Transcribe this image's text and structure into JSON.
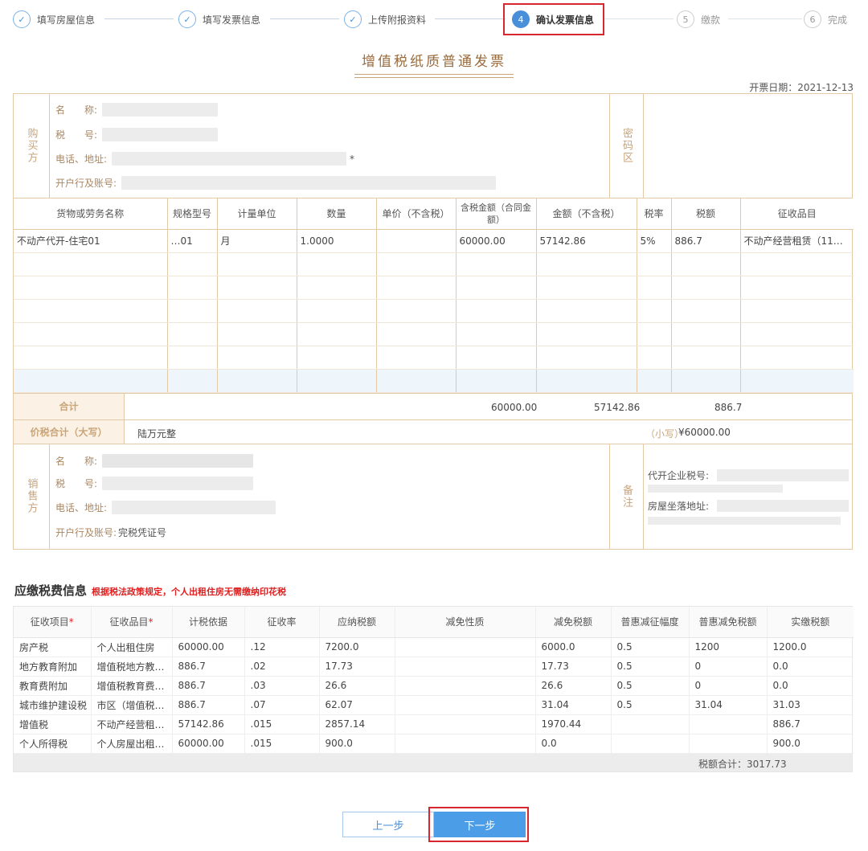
{
  "steps": [
    {
      "num": "✓",
      "label": "填写房屋信息",
      "state": "done"
    },
    {
      "num": "✓",
      "label": "填写发票信息",
      "state": "done"
    },
    {
      "num": "✓",
      "label": "上传附报资料",
      "state": "done"
    },
    {
      "num": "4",
      "label": "确认发票信息",
      "state": "active"
    },
    {
      "num": "5",
      "label": "缴款",
      "state": "todo"
    },
    {
      "num": "6",
      "label": "完成",
      "state": "todo"
    }
  ],
  "invoice": {
    "title": "增值税纸质普通发票",
    "date": "开票日期：2021-12-13",
    "buyer": {
      "side_label": "购买方",
      "name_label": "名　　称:",
      "tax_label": "税　　号:",
      "phone_label": "电话、地址:",
      "phone_mark": "*",
      "bank_label": "开户行及账号:"
    },
    "password_label": "密码区",
    "columns": [
      "货物或劳务名称",
      "规格型号",
      "计量单位",
      "数量",
      "单价（不含税）",
      "含税金额（合同金额）",
      "金额（不含税）",
      "税率",
      "税额",
      "征收品目"
    ],
    "item": {
      "name": "不动产代开-住宅01",
      "spec": "…01",
      "unit": "月",
      "qty": "1.0000",
      "price": "",
      "amount_incl": "60000.00",
      "amount_excl": "57142.86",
      "rate": "5%",
      "tax": "886.7",
      "category": "不动产经营租赁（11…"
    },
    "sum_label": "合计",
    "sum_amount_incl": "60000.00",
    "sum_amount_excl": "57142.86",
    "sum_tax": "886.7",
    "total_label": "价税合计（大写）",
    "total_words": "陆万元整",
    "total_small_label": "（小写）",
    "total_small": "¥60000.00",
    "seller": {
      "side_label": "销售方",
      "name_label": "名　　称:",
      "tax_label": "税　　号:",
      "phone_label": "电话、地址:",
      "bank_label": "开户行及账号:",
      "bank_value": "完税凭证号"
    },
    "remark_label": "备注",
    "remark_line1": "代开企业税号:",
    "remark_line2": "房屋坐落地址:"
  },
  "tax": {
    "title": "应缴税费信息",
    "note": "根据税法政策规定，个人出租住房无需缴纳印花税",
    "columns": [
      "征收项目",
      "征收品目",
      "计税依据",
      "征收率",
      "应纳税额",
      "减免性质",
      "减免税额",
      "普惠减征幅度",
      "普惠减免税额",
      "实缴税额"
    ],
    "rows": [
      [
        "房产税",
        "个人出租住房",
        "60000.00",
        ".12",
        "7200.0",
        "",
        "6000.0",
        "0.5",
        "1200",
        "1200.0"
      ],
      [
        "地方教育附加",
        "增值税地方教…",
        "886.7",
        ".02",
        "17.73",
        "",
        "17.73",
        "0.5",
        "0",
        "0.0"
      ],
      [
        "教育费附加",
        "增值税教育费…",
        "886.7",
        ".03",
        "26.6",
        "",
        "26.6",
        "0.5",
        "0",
        "0.0"
      ],
      [
        "城市维护建设税",
        "市区（增值税…",
        "886.7",
        ".07",
        "62.07",
        "",
        "31.04",
        "0.5",
        "31.04",
        "31.03"
      ],
      [
        "增值税",
        "不动产经营租…",
        "57142.86",
        ".015",
        "2857.14",
        "",
        "1970.44",
        "",
        "",
        "886.7"
      ],
      [
        "个人所得税",
        "个人房屋出租…",
        "60000.00",
        ".015",
        "900.0",
        "",
        "0.0",
        "",
        "",
        "900.0"
      ]
    ],
    "total": "税额合计：3017.73"
  },
  "buttons": {
    "prev": "上一步",
    "next": "下一步"
  }
}
